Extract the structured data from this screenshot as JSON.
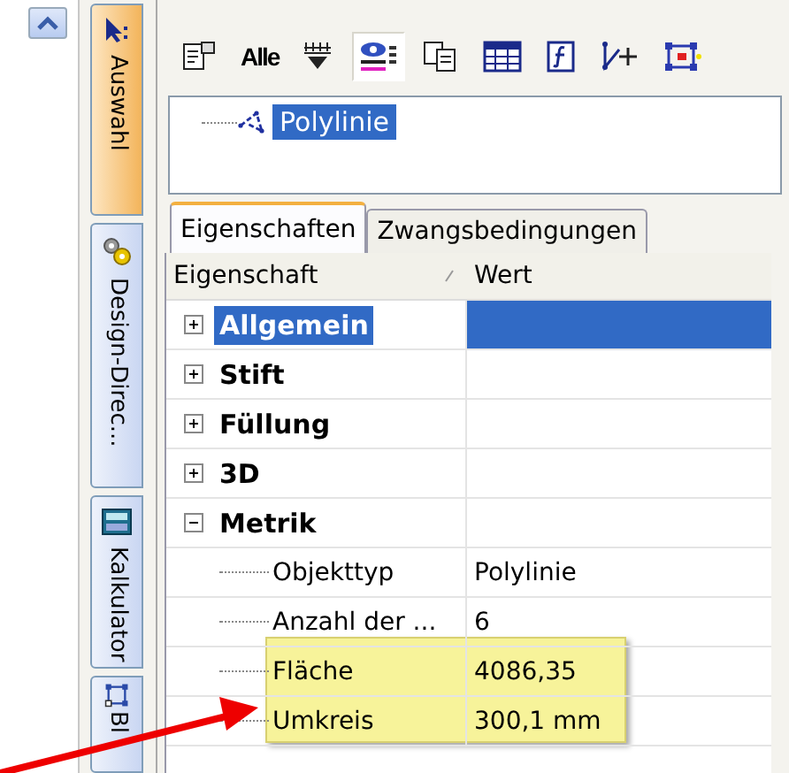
{
  "side_tabs": [
    {
      "label": "Auswahl",
      "selected": true
    },
    {
      "label": "Design-Direc...",
      "selected": false
    },
    {
      "label": "Kalkulator",
      "selected": false
    },
    {
      "label": "Bl",
      "selected": false
    }
  ],
  "toolbar": [
    {
      "kind": "icon",
      "pressed": false
    },
    {
      "kind": "text",
      "label": "Alle",
      "pressed": false
    },
    {
      "kind": "icon",
      "pressed": false
    },
    {
      "kind": "icon",
      "pressed": true
    },
    {
      "kind": "icon",
      "pressed": false
    },
    {
      "kind": "icon",
      "pressed": false
    },
    {
      "kind": "icon",
      "pressed": false
    },
    {
      "kind": "icon",
      "pressed": false
    },
    {
      "kind": "icon",
      "pressed": false
    }
  ],
  "object_tree": [
    {
      "label": "Polylinie",
      "selected": true
    }
  ],
  "tabs": [
    {
      "label": "Eigenschaften",
      "selected": true
    },
    {
      "label": "Zwangsbedingungen",
      "selected": false
    }
  ],
  "grid": {
    "columns": [
      "Eigenschaft",
      "Wert"
    ],
    "rows": [
      {
        "label": "Allgemein",
        "selected": true,
        "expanded": false
      },
      {
        "label": "Stift",
        "selected": false,
        "expanded": false
      },
      {
        "label": "Füllung",
        "selected": false,
        "expanded": false
      },
      {
        "label": "3D",
        "selected": false,
        "expanded": false
      },
      {
        "label": "Metrik",
        "selected": false,
        "expanded": true,
        "children": [
          {
            "label": "Objekttyp",
            "value": "Polylinie",
            "selected": false,
            "highlighted": false
          },
          {
            "label": "Anzahl der ...",
            "value": "6",
            "selected": false,
            "highlighted": false
          },
          {
            "label": "Fläche",
            "value": "4086,35",
            "selected": false,
            "highlighted": true
          },
          {
            "label": "Umkreis",
            "value": "300,1 mm",
            "selected": false,
            "highlighted": true
          }
        ]
      }
    ]
  }
}
